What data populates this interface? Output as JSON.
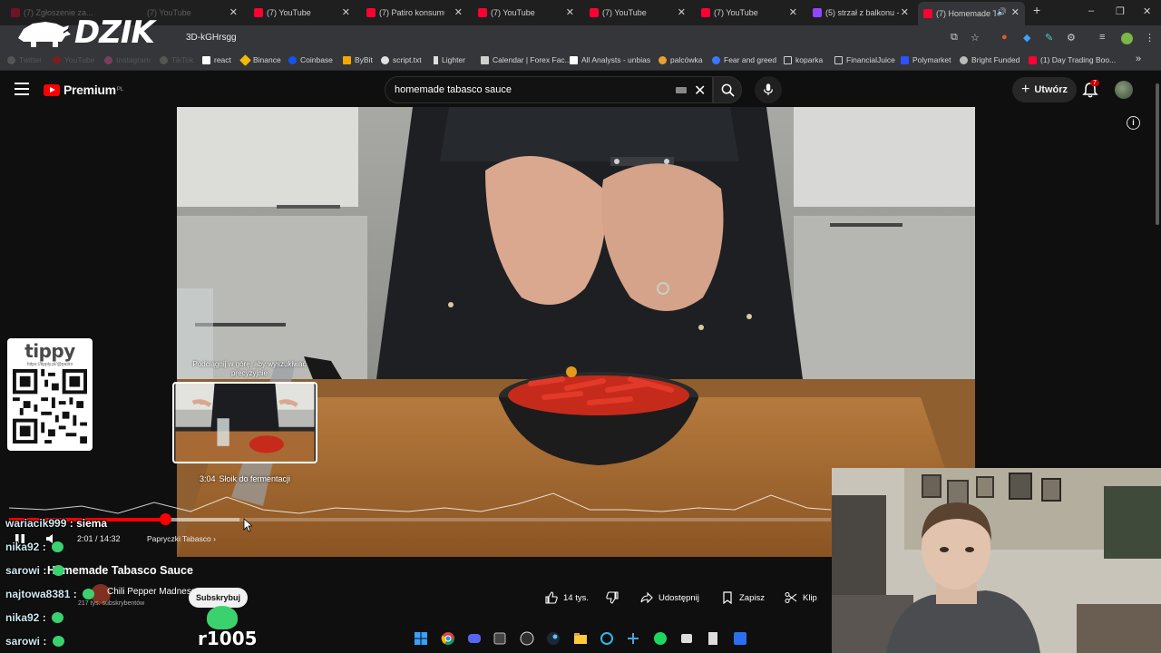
{
  "browser": {
    "tabs": [
      {
        "label": "(7) Zgłoszenie za...",
        "faded": true,
        "favicon_color": "#ff0033"
      },
      {
        "label": "(7) YouTube",
        "faded": false,
        "favicon_color": "#ff0033"
      },
      {
        "label": "(7) Patiro konsumuje",
        "faded": false,
        "favicon_color": "#ff0033"
      },
      {
        "label": "(7) YouTube",
        "faded": false,
        "favicon_color": "#ff0033"
      },
      {
        "label": "(7) YouTube",
        "faded": false,
        "favicon_color": "#ff0033"
      },
      {
        "label": "(7) YouTube",
        "faded": false,
        "favicon_color": "#ff0033"
      },
      {
        "label": "(5) strzał z balkonu -",
        "faded": false,
        "favicon_color": "#9146ff"
      },
      {
        "label": "(7) Homemade T",
        "faded": false,
        "favicon_color": "#ff0033",
        "active": true
      }
    ],
    "url_fragment": "3D-kGHrsgg",
    "bookmarks": [
      {
        "label": "Twitter",
        "dim": true,
        "color": "#555555"
      },
      {
        "label": "YouTube",
        "dim": true,
        "color": "#7a1f1f"
      },
      {
        "label": "Instagram",
        "dim": true,
        "color": "#7a3d5a"
      },
      {
        "label": "TikTok",
        "dim": true,
        "color": "#555555"
      },
      {
        "label": "react",
        "dim": false,
        "color": "#ffffff"
      },
      {
        "label": "Binance",
        "dim": false,
        "color": "#f0b90b"
      },
      {
        "label": "Coinbase",
        "dim": false,
        "color": "#1652f0"
      },
      {
        "label": "ByBit",
        "dim": false,
        "color": "#f7a600"
      },
      {
        "label": "script.txt",
        "dim": false,
        "color": "#e0e0e0"
      },
      {
        "label": "Lighter",
        "dim": false,
        "color": "#dddddd"
      },
      {
        "label": "Calendar | Forex Fac...",
        "dim": false,
        "color": "#cfcfcf"
      },
      {
        "label": "All Analysts - unbias",
        "dim": false,
        "color": "#ffffff"
      },
      {
        "label": "palcówka",
        "dim": false,
        "color": "#e8a030"
      },
      {
        "label": "Fear and greed",
        "dim": false,
        "color": "#3c78ff"
      },
      {
        "label": "koparka",
        "dim": false,
        "color": "#cfcfcf"
      },
      {
        "label": "FinancialJuice",
        "dim": false,
        "color": "#2a66c9"
      },
      {
        "label": "Polymarket",
        "dim": false,
        "color": "#3050ff"
      },
      {
        "label": "Bright Funded",
        "dim": false,
        "color": "#bbbbbb"
      },
      {
        "label": "(1) Day Trading Boo...",
        "dim": false,
        "color": "#ff0033"
      }
    ]
  },
  "overlay": {
    "logo_text": "DZIK",
    "tippy_title": "tippy",
    "tippy_url": "https://tipply.pl/@patiro",
    "chat": [
      {
        "user": "wariacik999",
        "sep": " : ",
        "message": "siema",
        "emote": false
      },
      {
        "user": "nika92",
        "sep": " : ",
        "message": "",
        "emote": true
      },
      {
        "user": "sarowi",
        "sep": " : ",
        "message": "",
        "emote": true
      },
      {
        "user": "najtowa8381",
        "sep": " : ",
        "message": "",
        "emote": true
      },
      {
        "user": "nika92",
        "sep": " : ",
        "message": "",
        "emote": true
      },
      {
        "user": "sarowi",
        "sep": " : ",
        "message": "",
        "emote": true
      }
    ],
    "sub_counter": "r1005"
  },
  "youtube": {
    "logo_label": "Premium",
    "region": "PL",
    "search_query": "homemade tabasco sauce",
    "create_label": "Utwórz",
    "notifications_count": "7",
    "seek_hint": "Podciągnij w górę, aby wyszukiwać precyzyjnie",
    "seek_time": "3:04",
    "seek_chapter": "Słoik do fermentacji",
    "current_time": "2:01 / 14:32",
    "chapter_label": "Papryczki Tabasco",
    "chapter_chevron": "›",
    "played_fraction": 0.19,
    "buffered_fraction": 0.28,
    "video_title": "Homemade Tabasco Sauce",
    "channel_name": "Chili Pepper Madness",
    "channel_subs": "217 tys. subskrybentów",
    "subscribe_label": "Subskrybuj",
    "actions": {
      "likes": "14 tys.",
      "share": "Udostępnij",
      "save": "Zapisz",
      "clip": "Klip"
    }
  }
}
